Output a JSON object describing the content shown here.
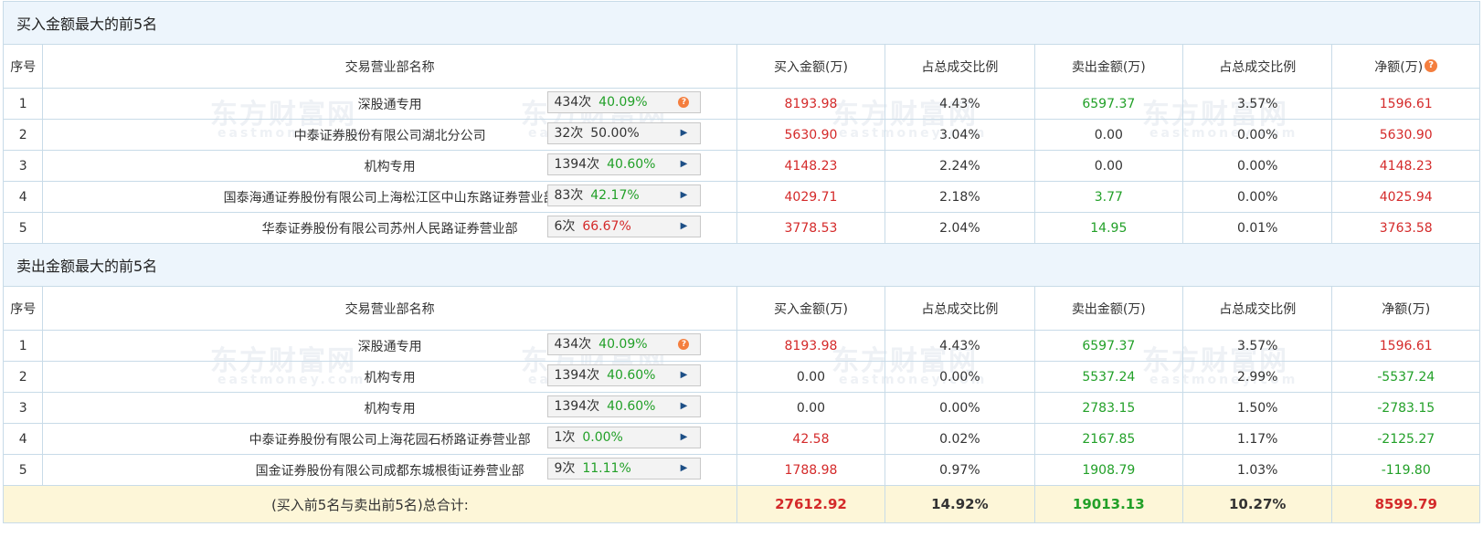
{
  "buy_section": {
    "title": "买入金额最大的前5名",
    "headers": {
      "seq": "序号",
      "name": "交易营业部名称",
      "buy": "买入金额(万)",
      "buy_ratio": "占总成交比例",
      "sell": "卖出金额(万)",
      "sell_ratio": "占总成交比例",
      "net": "净额(万)"
    },
    "rows": [
      {
        "seq": "1",
        "name": "深股通专用",
        "count": "434次",
        "rate": "40.09%",
        "rate_color": "green",
        "icon": "question-icon",
        "buy": "8193.98",
        "buy_ratio": "4.43%",
        "sell": "6597.37",
        "sell_ratio": "3.57%",
        "net": "1596.61"
      },
      {
        "seq": "2",
        "name": "中泰证券股份有限公司湖北分公司",
        "count": "32次",
        "rate": "50.00%",
        "rate_color": "dark",
        "icon": "arrow-right-icon",
        "buy": "5630.90",
        "buy_ratio": "3.04%",
        "sell": "0.00",
        "sell_ratio": "0.00%",
        "net": "5630.90"
      },
      {
        "seq": "3",
        "name": "机构专用",
        "count": "1394次",
        "rate": "40.60%",
        "rate_color": "green",
        "icon": "arrow-right-icon",
        "buy": "4148.23",
        "buy_ratio": "2.24%",
        "sell": "0.00",
        "sell_ratio": "0.00%",
        "net": "4148.23"
      },
      {
        "seq": "4",
        "name": "国泰海通证券股份有限公司上海松江区中山东路证券营业部",
        "count": "83次",
        "rate": "42.17%",
        "rate_color": "green",
        "icon": "arrow-right-icon",
        "buy": "4029.71",
        "buy_ratio": "2.18%",
        "sell": "3.77",
        "sell_ratio": "0.00%",
        "net": "4025.94"
      },
      {
        "seq": "5",
        "name": "华泰证券股份有限公司苏州人民路证券营业部",
        "count": "6次",
        "rate": "66.67%",
        "rate_color": "red",
        "icon": "arrow-right-icon",
        "buy": "3778.53",
        "buy_ratio": "2.04%",
        "sell": "14.95",
        "sell_ratio": "0.01%",
        "net": "3763.58"
      }
    ]
  },
  "sell_section": {
    "title": "卖出金额最大的前5名",
    "headers": {
      "seq": "序号",
      "name": "交易营业部名称",
      "buy": "买入金额(万)",
      "buy_ratio": "占总成交比例",
      "sell": "卖出金额(万)",
      "sell_ratio": "占总成交比例",
      "net": "净额(万)"
    },
    "rows": [
      {
        "seq": "1",
        "name": "深股通专用",
        "count": "434次",
        "rate": "40.09%",
        "rate_color": "green",
        "icon": "question-icon",
        "buy": "8193.98",
        "buy_ratio": "4.43%",
        "sell": "6597.37",
        "sell_ratio": "3.57%",
        "net": "1596.61"
      },
      {
        "seq": "2",
        "name": "机构专用",
        "count": "1394次",
        "rate": "40.60%",
        "rate_color": "green",
        "icon": "arrow-right-icon",
        "buy": "0.00",
        "buy_ratio": "0.00%",
        "sell": "5537.24",
        "sell_ratio": "2.99%",
        "net": "-5537.24"
      },
      {
        "seq": "3",
        "name": "机构专用",
        "count": "1394次",
        "rate": "40.60%",
        "rate_color": "green",
        "icon": "arrow-right-icon",
        "buy": "0.00",
        "buy_ratio": "0.00%",
        "sell": "2783.15",
        "sell_ratio": "1.50%",
        "net": "-2783.15"
      },
      {
        "seq": "4",
        "name": "中泰证券股份有限公司上海花园石桥路证券营业部",
        "count": "1次",
        "rate": "0.00%",
        "rate_color": "green",
        "icon": "arrow-right-icon",
        "buy": "42.58",
        "buy_ratio": "0.02%",
        "sell": "2167.85",
        "sell_ratio": "1.17%",
        "net": "-2125.27"
      },
      {
        "seq": "5",
        "name": "国金证券股份有限公司成都东城根街证券营业部",
        "count": "9次",
        "rate": "11.11%",
        "rate_color": "green",
        "icon": "arrow-right-icon",
        "buy": "1788.98",
        "buy_ratio": "0.97%",
        "sell": "1908.79",
        "sell_ratio": "1.03%",
        "net": "-119.80"
      }
    ]
  },
  "total": {
    "label": "(买入前5名与卖出前5名)总合计:",
    "buy": "27612.92",
    "buy_ratio": "14.92%",
    "sell": "19013.13",
    "sell_ratio": "10.27%",
    "net": "8599.79"
  },
  "watermark": {
    "cn": "东方财富网",
    "en": "eastmoney.com"
  },
  "colors": {
    "red": "#d42a2a",
    "green": "#22a028",
    "section_bg": "#edf5fc",
    "total_bg": "#fdf6d8",
    "border": "#c8dbe8"
  }
}
